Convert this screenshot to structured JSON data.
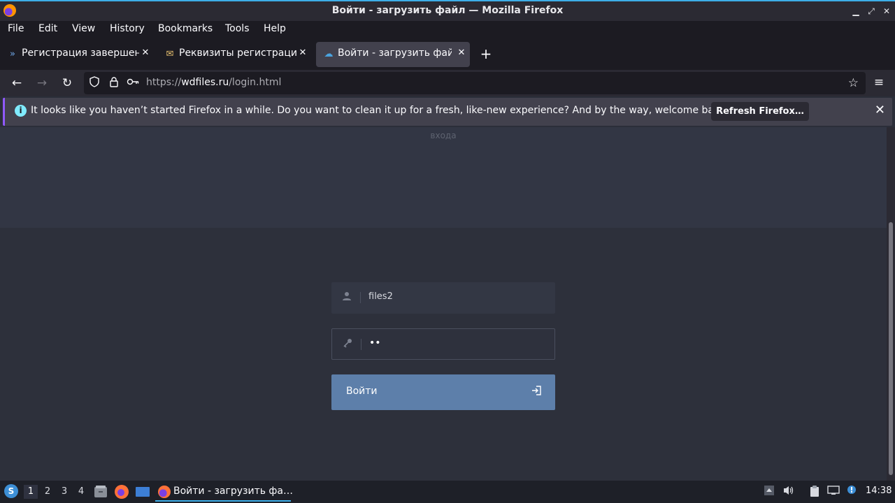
{
  "window": {
    "title": "Войти - загрузить файл — Mozilla Firefox",
    "minimize_icon": "▁",
    "maximize_icon": "⤢",
    "close_icon": "✕"
  },
  "menu": [
    "File",
    "Edit",
    "View",
    "History",
    "Bookmarks",
    "Tools",
    "Help"
  ],
  "tabs": [
    {
      "label": "Регистрация завершена",
      "icon": "»",
      "active": false
    },
    {
      "label": "Реквизиты регистрации",
      "icon": "✉",
      "active": false
    },
    {
      "label": "Войти - загрузить файл",
      "icon": "☁",
      "active": true
    }
  ],
  "tab_close_glyph": "✕",
  "new_tab_glyph": "+",
  "nav": {
    "back": "←",
    "forward": "→",
    "reload": "↻",
    "url_scheme": "https://",
    "url_domain": "wdfiles.ru",
    "url_path": "/login.html",
    "menu_glyph": "≡",
    "star_glyph": "☆"
  },
  "notification": {
    "message": "It looks like you haven’t started Firefox in a while. Do you want to clean it up for a fresh, like-new experience? And by the way, welcome back!",
    "button": "Refresh Firefox…",
    "info_glyph": "i",
    "close_glyph": "✕"
  },
  "page": {
    "top_caption": "входа",
    "username_value": "files2",
    "password_value": "••",
    "login_button": "Войти",
    "login_icon": "⇥"
  },
  "taskbar": {
    "workspaces": [
      "1",
      "2",
      "3",
      "4"
    ],
    "active_workspace": "1",
    "task_label": "Войти - загрузить фа…",
    "clock": "14:38"
  }
}
